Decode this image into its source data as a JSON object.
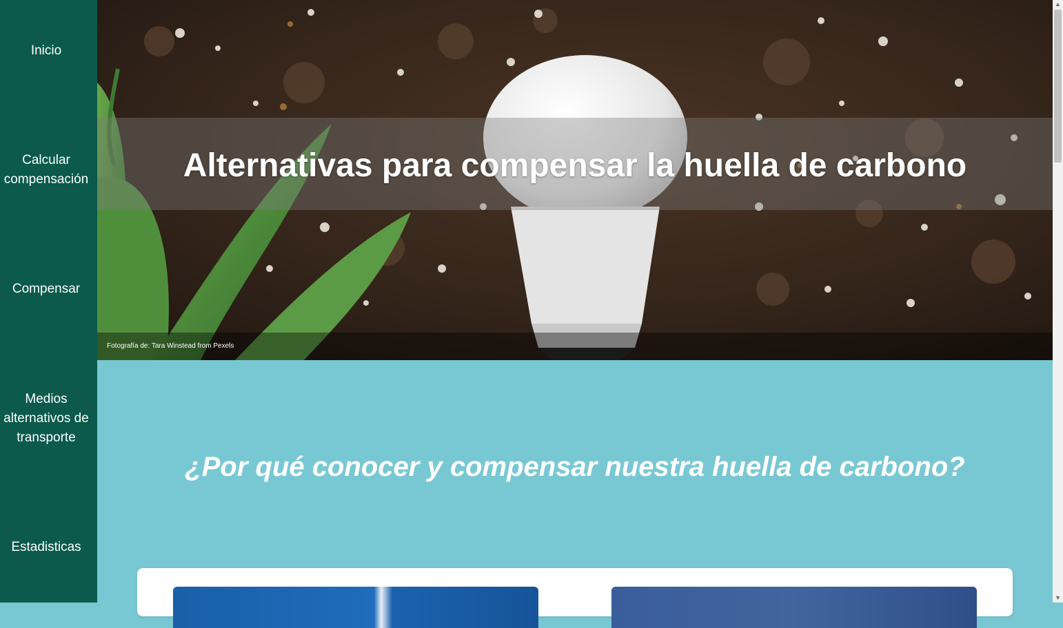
{
  "nav": {
    "items": [
      {
        "label": "Inicio"
      },
      {
        "label": "Calcular compensación"
      },
      {
        "label": "Compensar"
      },
      {
        "label": "Medios alternativos de transporte"
      },
      {
        "label": "Estadisticas"
      }
    ]
  },
  "hero": {
    "title": "Alternativas para compensar la huella de carbono",
    "caption": "Fotografía de: Tara Winstead from Pexels"
  },
  "section": {
    "title": "¿Por qué conocer y compensar nuestra huella de carbono?"
  },
  "colors": {
    "sidebar": "#0b5a4c",
    "section_bg": "#78c8d4",
    "text": "#ffffff"
  },
  "icons": {
    "scroll_up": "▲",
    "scroll_down": "▼"
  }
}
